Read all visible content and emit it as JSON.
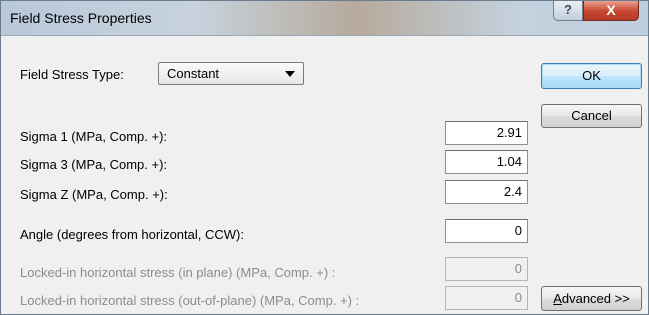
{
  "window": {
    "title": "Field Stress Properties",
    "help_label": "?",
    "close_label": "X"
  },
  "form": {
    "type_label": "Field Stress Type:",
    "type_value": "Constant",
    "sigma1": {
      "label": "Sigma 1 (MPa, Comp. +):",
      "value": "2.91"
    },
    "sigma3": {
      "label": "Sigma 3 (MPa, Comp. +):",
      "value": "1.04"
    },
    "sigmaz": {
      "label": "Sigma Z (MPa, Comp. +):",
      "value": "2.4"
    },
    "angle": {
      "label": "Angle (degrees from horizontal, CCW):",
      "value": "0"
    },
    "locked_in_plane": {
      "label": "Locked-in horizontal stress (in plane) (MPa, Comp. +) :",
      "value": "0",
      "enabled": false
    },
    "locked_out_plane": {
      "label": "Locked-in horizontal stress (out-of-plane) (MPa, Comp. +) :",
      "value": "0",
      "enabled": false
    }
  },
  "buttons": {
    "ok": "OK",
    "cancel": "Cancel",
    "advanced_mnemonic": "A",
    "advanced_rest": "dvanced >>"
  }
}
